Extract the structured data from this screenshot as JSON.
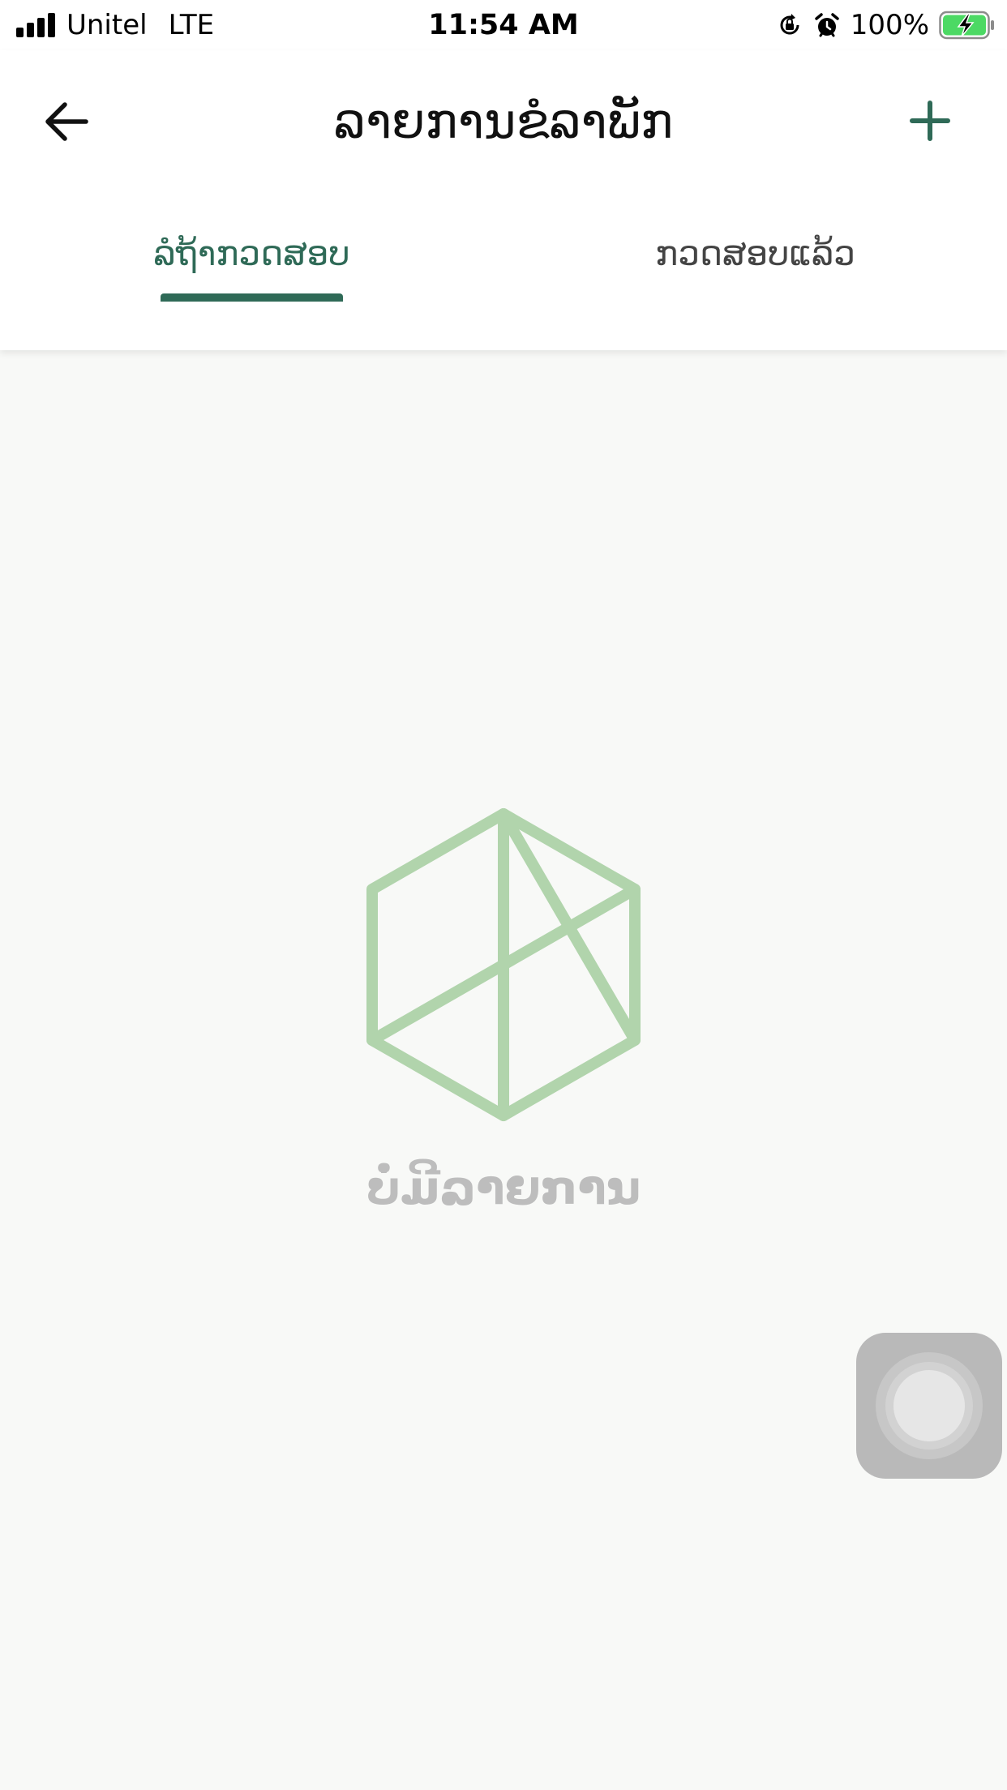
{
  "status_bar": {
    "carrier": "Unitel",
    "network": "LTE",
    "time": "11:54 AM",
    "battery_percent": "100%",
    "battery_level": 1.0,
    "icons": [
      "signal-icon",
      "orientation-lock-icon",
      "alarm-icon",
      "battery-charging-icon"
    ]
  },
  "header": {
    "title": "ລາຍການຂໍລາພັກ",
    "back_icon": "arrow-left-icon",
    "add_icon": "plus-icon"
  },
  "tabs": [
    {
      "label": "ລໍຖ້າກວດສອບ",
      "active": true
    },
    {
      "label": "ກວດສອບແລ້ວ",
      "active": false
    }
  ],
  "empty_state": {
    "icon": "empty-box-icon",
    "message": "ບໍ່ມີລາຍການ"
  },
  "colors": {
    "accent": "#2f6a57",
    "empty_icon": "#b1d4ac",
    "empty_text": "#bdbdbd",
    "background": "#f8f9f7",
    "battery_fill": "#4cd964"
  }
}
